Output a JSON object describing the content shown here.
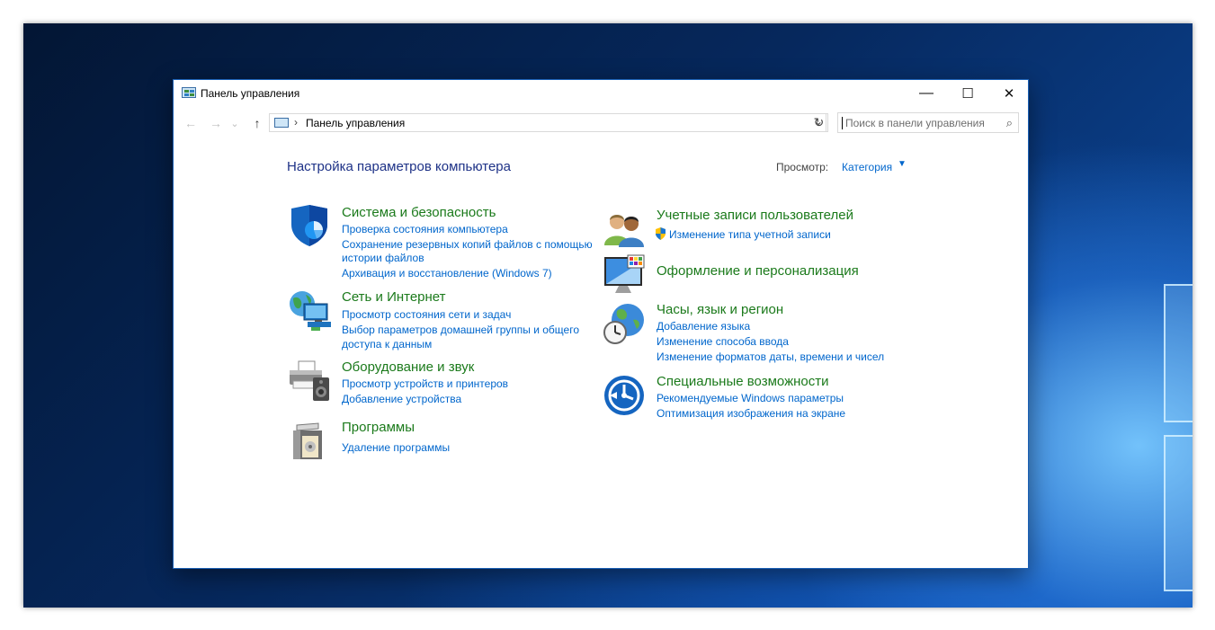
{
  "window": {
    "title": "Панель управления",
    "minimize": "—",
    "maximize": "☐",
    "close": "✕"
  },
  "nav": {
    "back": "←",
    "forward": "→",
    "recent": "⌄",
    "up": "↑",
    "address_sep": "›",
    "address": "Панель управления",
    "address_dropdown": "⌄",
    "refresh": "↻",
    "search_placeholder": "Поиск в панели управления",
    "search_icon": "⌕"
  },
  "main": {
    "heading": "Настройка параметров компьютера",
    "view_label": "Просмотр:",
    "view_value": "Категория",
    "view_caret": "▼"
  },
  "categories": {
    "system": {
      "icon": "shield-icon",
      "title": "Система и безопасность",
      "links": [
        "Проверка состояния компьютера",
        "Сохранение резервных копий файлов с помощью",
        "истории файлов",
        "Архивация и восстановление (Windows 7)"
      ]
    },
    "network": {
      "icon": "network-globe-icon",
      "title": "Сеть и Интернет",
      "links": [
        "Просмотр состояния сети и задач",
        "Выбор параметров домашней группы и общего",
        "доступа к данным"
      ]
    },
    "hardware": {
      "icon": "printer-speaker-icon",
      "title": "Оборудование и звук",
      "links": [
        "Просмотр устройств и принтеров",
        "Добавление устройства"
      ]
    },
    "programs": {
      "icon": "programs-box-icon",
      "title": "Программы",
      "links": [
        "Удаление программы"
      ]
    },
    "accounts": {
      "icon": "users-icon",
      "title": "Учетные записи пользователей",
      "links": [
        "Изменение типа учетной записи"
      ]
    },
    "appearance": {
      "icon": "monitor-palette-icon",
      "title": "Оформление и персонализация",
      "links": []
    },
    "clock": {
      "icon": "clock-globe-icon",
      "title": "Часы, язык и регион",
      "links": [
        "Добавление языка",
        "Изменение способа ввода",
        "Изменение форматов даты, времени и чисел"
      ]
    },
    "access": {
      "icon": "accessibility-icon",
      "title": "Специальные возможности",
      "links": [
        "Рекомендуемые Windows параметры",
        "Оптимизация изображения на экране"
      ]
    }
  }
}
